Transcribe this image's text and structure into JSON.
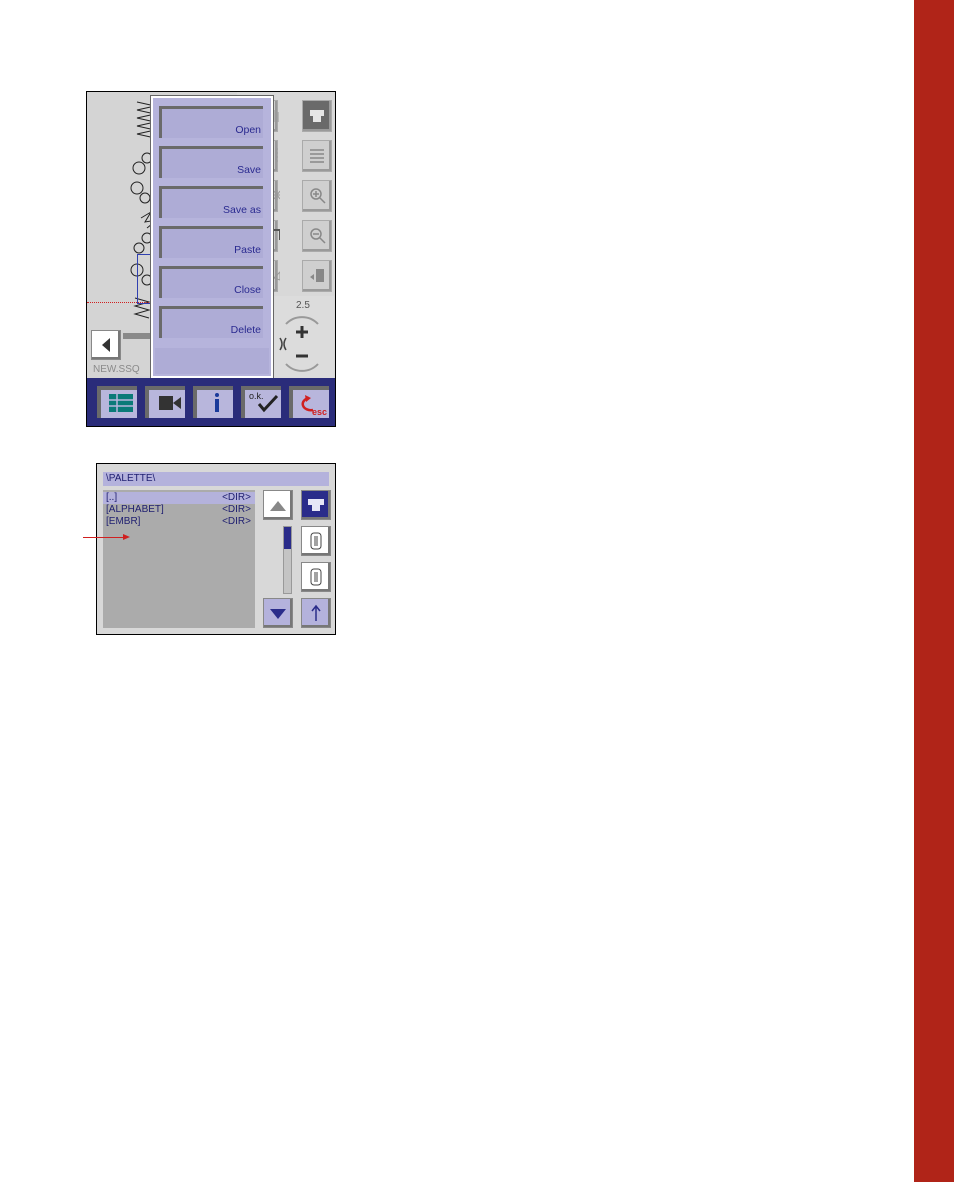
{
  "colors": {
    "side_bar": "#b02418",
    "menu_bg": "#b6b4dc",
    "menu_text": "#2a2a90",
    "bottom_bar": "#2a2c7a",
    "accent_red": "#d02020"
  },
  "screen1": {
    "filename": "NEW.SSQ",
    "zoom_value": "2.5",
    "menu": {
      "items": [
        {
          "label": "Open"
        },
        {
          "label": "Save"
        },
        {
          "label": "Save as"
        },
        {
          "label": "Paste"
        },
        {
          "label": "Close"
        },
        {
          "label": "Delete"
        }
      ]
    },
    "tools_right_icons": [
      "sewing-machine-icon",
      "list-icon",
      "zoom-in-icon",
      "zoom-out-icon",
      "move-to-page-icon"
    ],
    "tools_left_icons": [
      "stitch-length-icon",
      "dotted-line-icon",
      "sparkle-icon",
      "arrow-corner-icon",
      "eraser-icon"
    ],
    "bottom_bar": {
      "ok_label": "o.k.",
      "esc_label": "esc"
    }
  },
  "screen2": {
    "path": "\\PALETTE\\",
    "files": [
      {
        "name": "[..]",
        "type": "<DIR>",
        "selected": true
      },
      {
        "name": "[ALPHABET]",
        "type": "<DIR>",
        "selected": false
      },
      {
        "name": "[EMBR]",
        "type": "<DIR>",
        "selected": false
      }
    ],
    "scroll_position": 0
  }
}
